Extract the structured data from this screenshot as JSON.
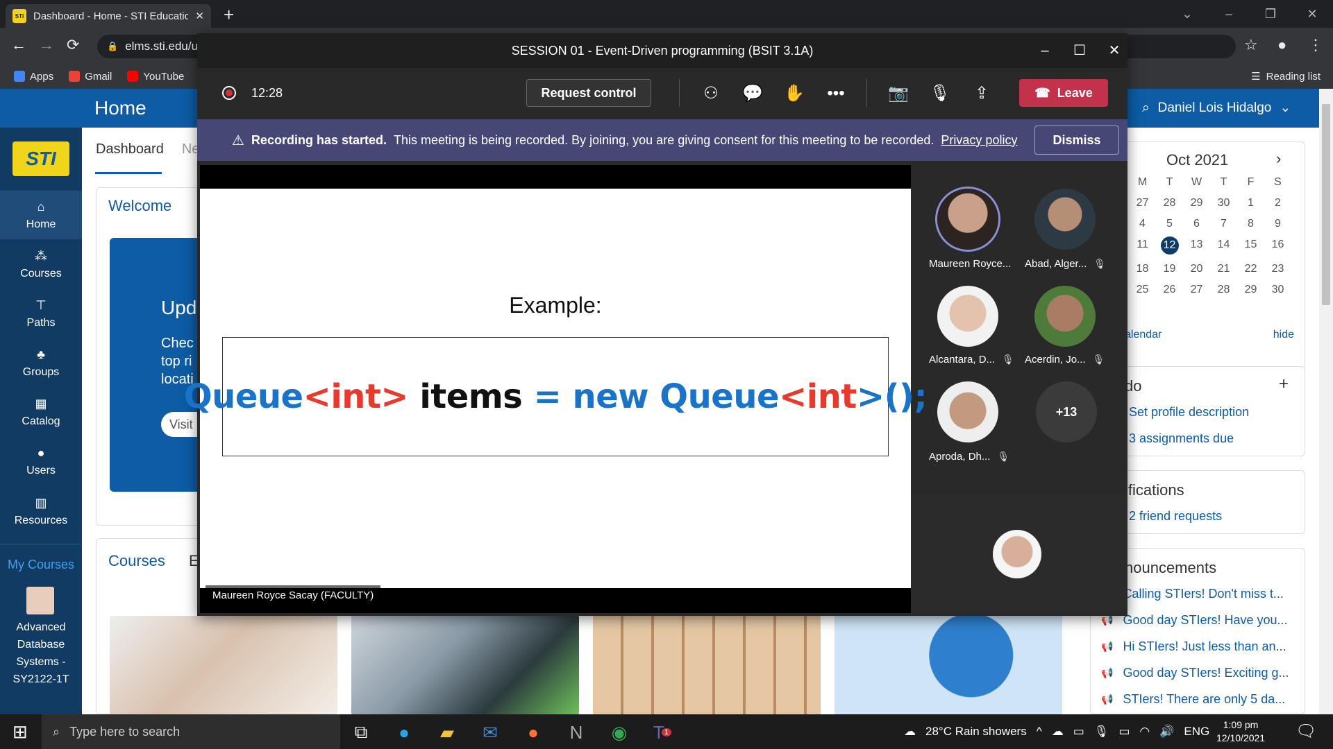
{
  "browser": {
    "tab_title": "Dashboard - Home - STI Educatic",
    "tab_favicon": "STI",
    "url": "elms.sti.edu/u",
    "bookmarks": [
      {
        "label": "Apps",
        "icon": "apps-grid-icon",
        "color": "#4285f4"
      },
      {
        "label": "Gmail",
        "icon": "gmail-icon",
        "color": "#ea4335"
      },
      {
        "label": "YouTube",
        "icon": "youtube-icon",
        "color": "#ff0000"
      }
    ],
    "reading_list": "Reading list"
  },
  "site": {
    "header_title": "Home",
    "user_name": "Daniel Lois Hidalgo",
    "logo_text": "STI",
    "nav": [
      {
        "label": "Home",
        "icon": "home-icon"
      },
      {
        "label": "Courses",
        "icon": "courses-icon"
      },
      {
        "label": "Paths",
        "icon": "paths-icon"
      },
      {
        "label": "Groups",
        "icon": "groups-icon"
      },
      {
        "label": "Catalog",
        "icon": "catalog-icon"
      },
      {
        "label": "Users",
        "icon": "users-icon"
      },
      {
        "label": "Resources",
        "icon": "resources-icon"
      }
    ],
    "my_courses_label": "My Courses",
    "course_item": "Advanced Database Systems - SY2122-1T",
    "dash_tabs": [
      "Dashboard",
      "Ne"
    ],
    "welcome_title": "Welcome",
    "update_title": "Upd",
    "update_text": [
      "Chec",
      "top ri",
      "locati"
    ],
    "visit_btn": "Visit",
    "courses_title": "Courses",
    "courses_tab2": "E"
  },
  "calendar": {
    "month": "Oct 2021",
    "weekdays": [
      "M",
      "T",
      "W",
      "T",
      "F",
      "S"
    ],
    "rows": [
      [
        "27",
        "28",
        "29",
        "30",
        "1",
        "2"
      ],
      [
        "4",
        "5",
        "6",
        "7",
        "8",
        "9"
      ],
      [
        "11",
        "12",
        "13",
        "14",
        "15",
        "16"
      ],
      [
        "18",
        "19",
        "20",
        "21",
        "22",
        "23"
      ],
      [
        "25",
        "26",
        "27",
        "28",
        "29",
        "30"
      ]
    ],
    "today": "12",
    "link_left": "alendar",
    "link_right": "hide"
  },
  "todo": {
    "title": "do",
    "items": [
      "Set profile description",
      "3 assignments due"
    ]
  },
  "notifications": {
    "title": "ifications",
    "items": [
      "2 friend requests"
    ]
  },
  "announcements": {
    "title": "nouncements",
    "items": [
      "Calling STIers! Don't miss t...",
      "Good day STIers! Have you...",
      "Hi STIers! Just less than an...",
      "Good day STIers! Exciting g...",
      "STIers! There are only 5 da..."
    ]
  },
  "teams": {
    "window_title": "SESSION 01 - Event-Driven programming (BSIT 3.1A)",
    "timer": "12:28",
    "request_control": "Request control",
    "leave": "Leave",
    "banner_bold": "Recording has started.",
    "banner_text": "This meeting is being recorded. By joining, you are giving consent for this meeting to be recorded.",
    "banner_link": "Privacy policy",
    "dismiss": "Dismiss",
    "slide_heading": "Example:",
    "code_tokens": [
      {
        "t": "Queue",
        "c": "blue"
      },
      {
        "t": "<",
        "c": "red"
      },
      {
        "t": "int",
        "c": "red"
      },
      {
        "t": ">",
        "c": "red"
      },
      {
        "t": " items ",
        "c": "black"
      },
      {
        "t": "= new Queue",
        "c": "blue"
      },
      {
        "t": "<",
        "c": "red"
      },
      {
        "t": "int",
        "c": "red"
      },
      {
        "t": ">();",
        "c": "blue"
      }
    ],
    "speaker_tag": "Maureen Royce Sacay (FACULTY)",
    "participants": [
      {
        "name": "Maureen Royce...",
        "muted": false,
        "active": true
      },
      {
        "name": "Abad, Alger...",
        "muted": true,
        "active": false
      },
      {
        "name": "Alcantara, D...",
        "muted": true,
        "active": false
      },
      {
        "name": "Acerdin, Jo...",
        "muted": true,
        "active": false
      },
      {
        "name": "Aproda, Dh...",
        "muted": true,
        "active": false
      }
    ],
    "more_count": "+13"
  },
  "taskbar": {
    "search_placeholder": "Type here to search",
    "weather": "28°C  Rain showers",
    "lang": "ENG",
    "time": "1:09 pm",
    "date": "12/10/2021",
    "teams_badge": "1"
  },
  "colors": {
    "sti_blue": "#0d5ca5",
    "sidebar": "#123b63",
    "teams_leave": "#c4314b",
    "teams_banner": "#464775",
    "code_blue": "#1873c9",
    "code_red": "#e53a2c"
  }
}
